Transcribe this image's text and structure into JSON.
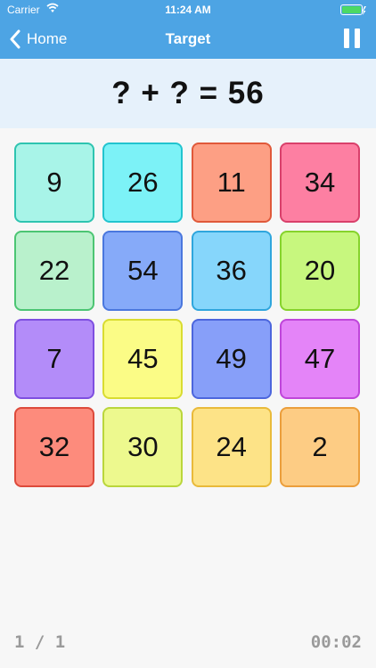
{
  "status": {
    "carrier": "Carrier",
    "time": "11:24 AM"
  },
  "nav": {
    "back_label": "Home",
    "title": "Target"
  },
  "equation": {
    "text": "? + ? = 56"
  },
  "tiles": [
    {
      "label": "9",
      "bg": "#a8f4e8",
      "border": "#2ec4b0"
    },
    {
      "label": "26",
      "bg": "#7cf2f7",
      "border": "#22c4cf"
    },
    {
      "label": "11",
      "bg": "#fd9f84",
      "border": "#e0593a"
    },
    {
      "label": "34",
      "bg": "#fd7fa2",
      "border": "#d9406b"
    },
    {
      "label": "22",
      "bg": "#b9f1cc",
      "border": "#4cc573"
    },
    {
      "label": "54",
      "bg": "#86aaf9",
      "border": "#4a77de"
    },
    {
      "label": "36",
      "bg": "#86d6fb",
      "border": "#2fa6dd"
    },
    {
      "label": "20",
      "bg": "#c7f77e",
      "border": "#86d32c"
    },
    {
      "label": "7",
      "bg": "#b38cf9",
      "border": "#7e4fe0"
    },
    {
      "label": "45",
      "bg": "#fbfc86",
      "border": "#d9dc31"
    },
    {
      "label": "49",
      "bg": "#879ff9",
      "border": "#4c66dd"
    },
    {
      "label": "47",
      "bg": "#e484f8",
      "border": "#bf46da"
    },
    {
      "label": "32",
      "bg": "#fd8b7c",
      "border": "#dd4a3b"
    },
    {
      "label": "30",
      "bg": "#edf98e",
      "border": "#bad63b"
    },
    {
      "label": "24",
      "bg": "#fde387",
      "border": "#e9ba3a"
    },
    {
      "label": "2",
      "bg": "#fdcc84",
      "border": "#eb9e3c"
    }
  ],
  "footer": {
    "progress": "1 / 1",
    "timer": "00:02"
  }
}
